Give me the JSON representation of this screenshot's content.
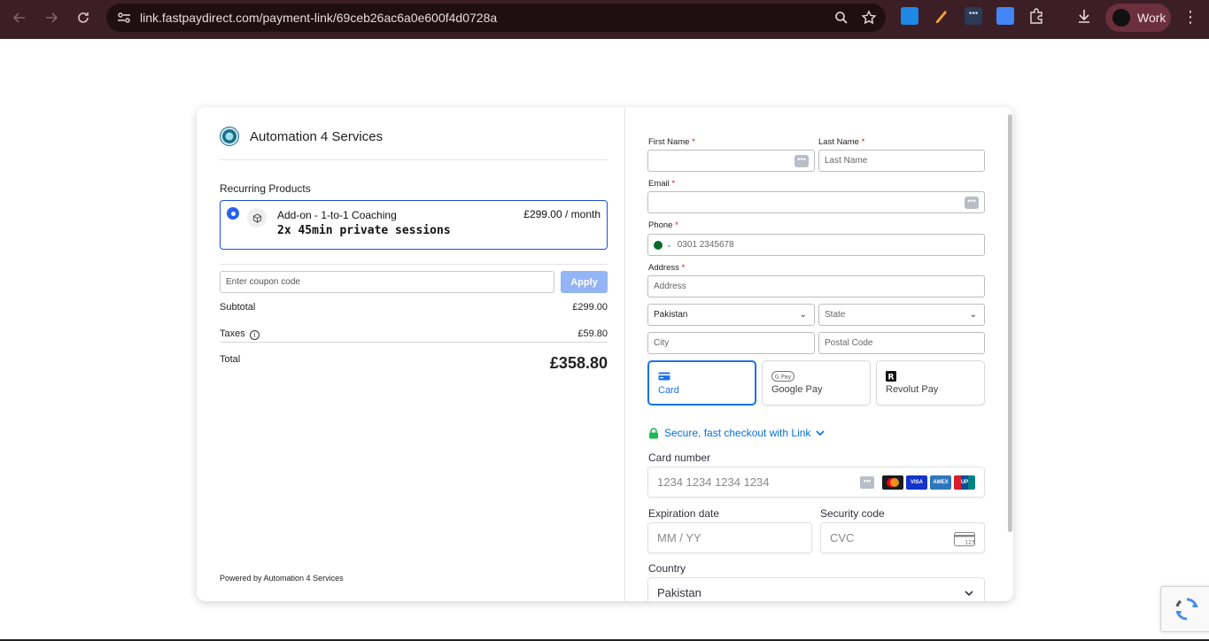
{
  "browser": {
    "url": "link.fastpaydirect.com/payment-link/69ceb26ac6a0e600f4d0728a",
    "profile_label": "Work"
  },
  "summary": {
    "merchant_name": "Automation 4 Services",
    "section_title": "Recurring Products",
    "product": {
      "name": "Add-on - 1-to-1 Coaching",
      "description": "2x 45min private sessions",
      "price": "£299.00 / month"
    },
    "coupon_placeholder": "Enter coupon code",
    "apply_label": "Apply",
    "subtotal_label": "Subtotal",
    "subtotal_value": "£299.00",
    "taxes_label": "Taxes",
    "taxes_value": "£59.80",
    "total_label": "Total",
    "total_value": "£358.80",
    "powered_by": "Powered by Automation 4 Services"
  },
  "form": {
    "first_name_label": "First Name",
    "last_name_label": "Last Name",
    "last_name_placeholder": "Last Name",
    "email_label": "Email",
    "phone_label": "Phone",
    "phone_placeholder": "0301 2345678",
    "address_label": "Address",
    "address_placeholder": "Address",
    "country_value": "Pakistan",
    "state_placeholder": "State",
    "city_placeholder": "City",
    "postal_placeholder": "Postal Code",
    "required_mark": "*"
  },
  "payment": {
    "methods": [
      {
        "label": "Card",
        "active": true
      },
      {
        "label": "Google Pay",
        "active": false
      },
      {
        "label": "Revolut Pay",
        "active": false
      }
    ],
    "link_text": "Secure, fast checkout with Link",
    "card_number_label": "Card number",
    "card_number_placeholder": "1234 1234 1234 1234",
    "expiry_label": "Expiration date",
    "expiry_placeholder": "MM / YY",
    "cvc_label": "Security code",
    "cvc_placeholder": "CVC",
    "country_label": "Country",
    "country_value": "Pakistan",
    "accent_color": "#1a73e8",
    "link_color": "#0570de"
  }
}
